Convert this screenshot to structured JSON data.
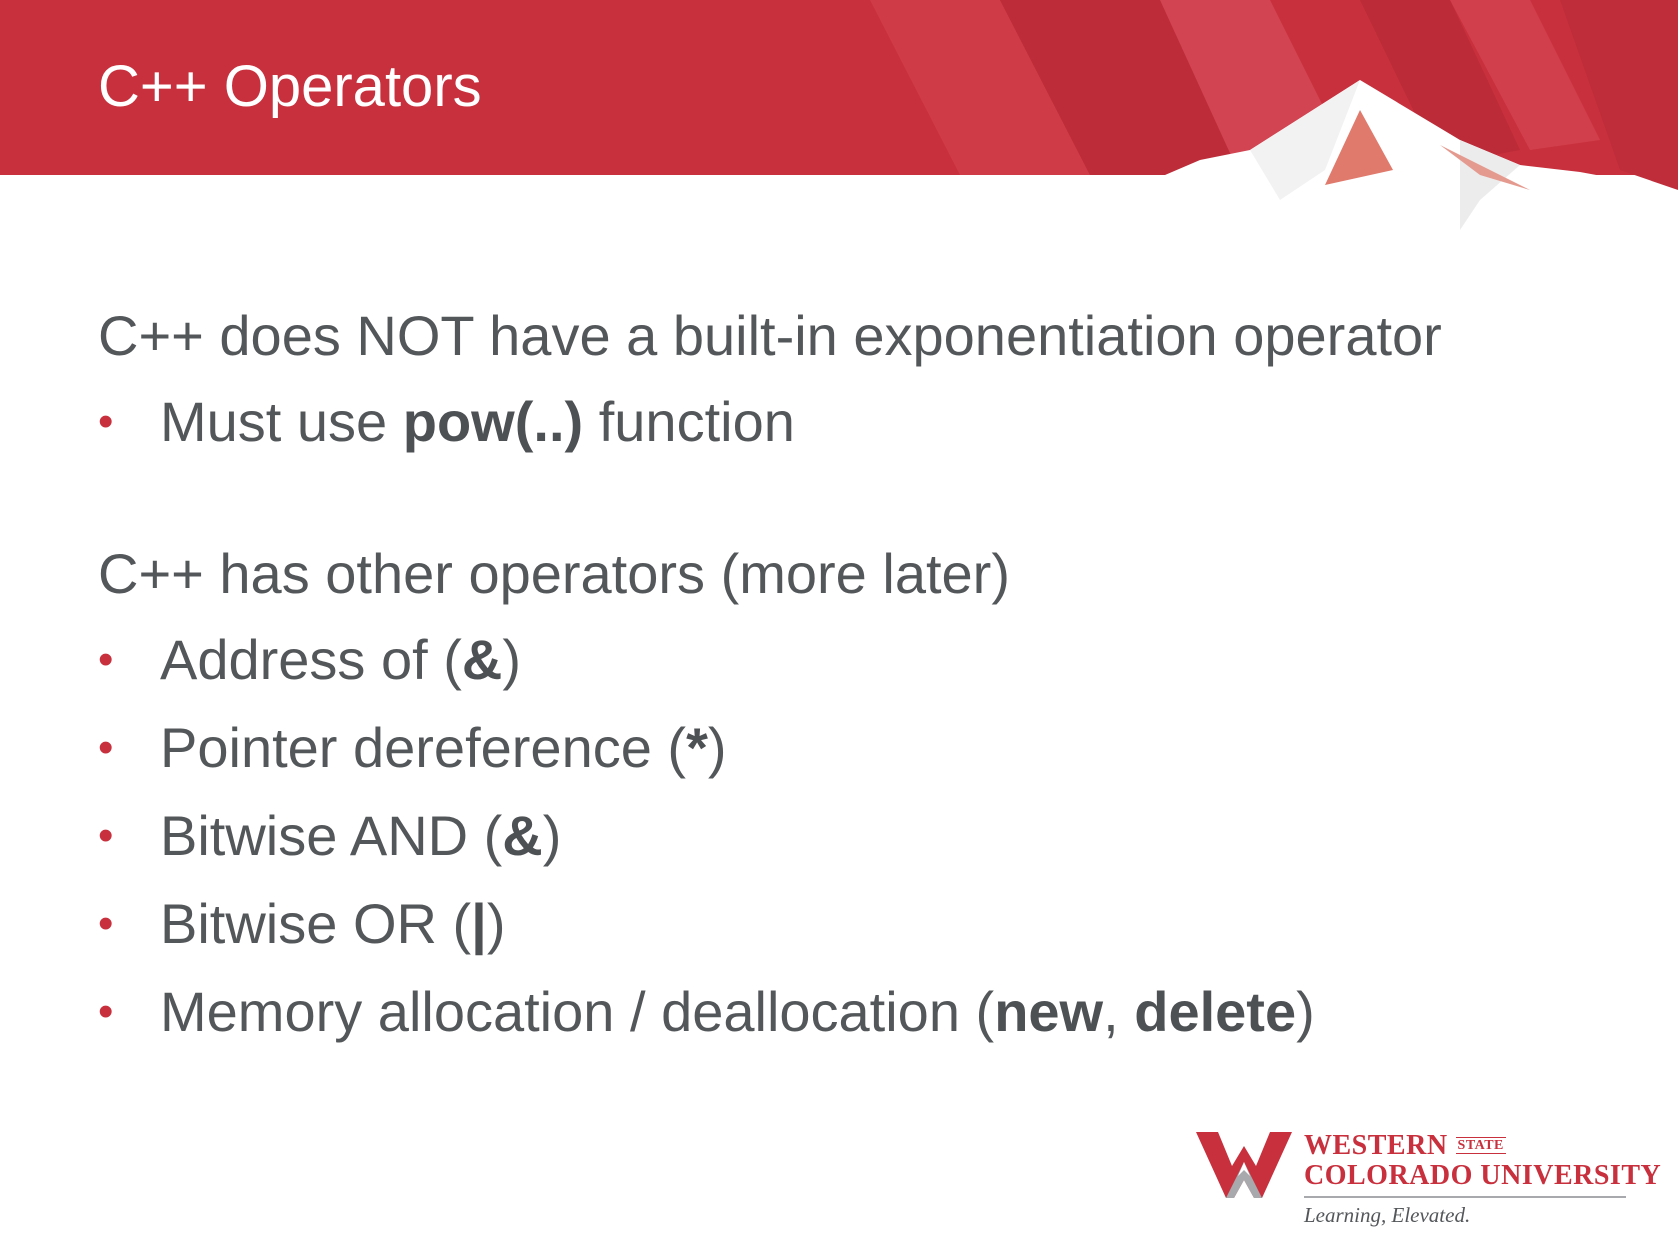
{
  "slide": {
    "title": "C++ Operators",
    "colors": {
      "banner_red": "#c8303d",
      "banner_dark_red": "#b52a36",
      "body_text": "#54575a",
      "bullet": "#c8303d"
    },
    "sections": [
      {
        "heading": "C++ does NOT have a built-in exponentiation operator",
        "bullets": [
          {
            "parts": [
              {
                "text": "Must use "
              },
              {
                "text": "pow(..)",
                "bold": true
              },
              {
                "text": " function"
              }
            ]
          }
        ]
      },
      {
        "heading": "C++ has other operators (more later)",
        "bullets": [
          {
            "parts": [
              {
                "text": "Address of ("
              },
              {
                "text": "&",
                "bold": true
              },
              {
                "text": ")"
              }
            ]
          },
          {
            "parts": [
              {
                "text": "Pointer dereference ("
              },
              {
                "text": "*",
                "bold": true
              },
              {
                "text": ")"
              }
            ]
          },
          {
            "parts": [
              {
                "text": "Bitwise AND ("
              },
              {
                "text": "&",
                "bold": true
              },
              {
                "text": ")"
              }
            ]
          },
          {
            "parts": [
              {
                "text": "Bitwise OR ("
              },
              {
                "text": "|",
                "bold": true
              },
              {
                "text": ")"
              }
            ]
          },
          {
            "parts": [
              {
                "text": "Memory allocation / deallocation ("
              },
              {
                "text": "new",
                "bold": true
              },
              {
                "text": ", "
              },
              {
                "text": "delete",
                "bold": true
              },
              {
                "text": ")"
              }
            ]
          }
        ]
      }
    ]
  },
  "logo": {
    "line1": "WESTERN",
    "state": "STATE",
    "line2": "COLORADO UNIVERSITY",
    "tagline": "Learning, Elevated."
  }
}
